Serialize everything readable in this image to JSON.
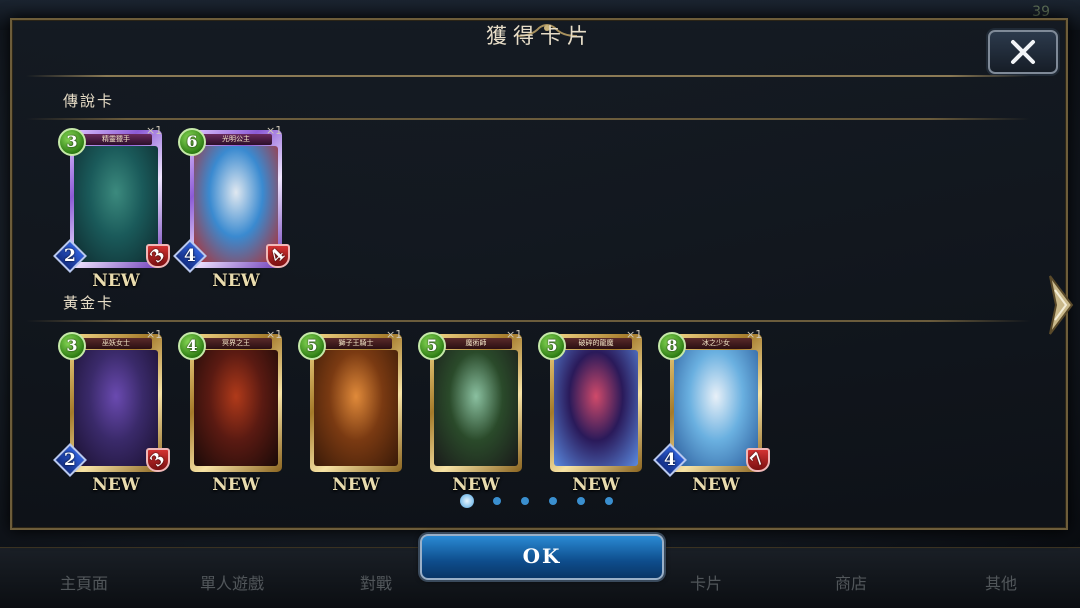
{
  "status_bar": {
    "clock": "39"
  },
  "dialog": {
    "title": "獲得卡片",
    "close_label": "✕",
    "ok_label": "OK"
  },
  "sections": [
    {
      "label": "傳說卡",
      "cards": [
        {
          "name": "精靈獵手",
          "cost": "3",
          "attack": "2",
          "defense": "3",
          "count": "×1",
          "badge": "NEW",
          "art": [
            "#1a5a5a",
            "#3c8a7e",
            "#0e2a2e"
          ]
        },
        {
          "name": "光明公主",
          "cost": "6",
          "attack": "4",
          "defense": "4",
          "count": "×1",
          "badge": "NEW",
          "art": [
            "#3a8ad0",
            "#e0e8f0",
            "#b82a2a"
          ]
        }
      ]
    },
    {
      "label": "黃金卡",
      "cards": [
        {
          "name": "巫妖女士",
          "cost": "3",
          "attack": "2",
          "defense": "3",
          "count": "×1",
          "badge": "NEW",
          "art": [
            "#3a2a6a",
            "#6a4ab0",
            "#1a1030"
          ]
        },
        {
          "name": "冥界之王",
          "cost": "4",
          "attack": "",
          "defense": "",
          "count": "×1",
          "badge": "NEW",
          "art": [
            "#5a1a12",
            "#b03a1a",
            "#1a0a08"
          ]
        },
        {
          "name": "獅子王騎士",
          "cost": "5",
          "attack": "",
          "defense": "",
          "count": "×1",
          "badge": "NEW",
          "art": [
            "#7a3a12",
            "#e08a3a",
            "#3a1a08"
          ]
        },
        {
          "name": "魔術師",
          "cost": "5",
          "attack": "",
          "defense": "",
          "count": "×1",
          "badge": "NEW",
          "art": [
            "#2a4a2a",
            "#8ac0a0",
            "#1a1a1a"
          ]
        },
        {
          "name": "破碎的龍魔",
          "cost": "5",
          "attack": "",
          "defense": "",
          "count": "×1",
          "badge": "NEW",
          "art": [
            "#2a1a5a",
            "#d04a6a",
            "#5a8ae0"
          ]
        },
        {
          "name": "冰之少女",
          "cost": "8",
          "attack": "4",
          "defense": "7",
          "count": "×1",
          "badge": "NEW",
          "art": [
            "#6ab0e0",
            "#e8f0f8",
            "#2a5a9a"
          ]
        }
      ]
    }
  ],
  "background_nav": [
    "主頁面",
    "單人遊戲",
    "對戰",
    "卡片",
    "商店",
    "其他"
  ],
  "pager": {
    "count": 6,
    "active": 0
  },
  "colors": {
    "accent": "#1a6fb8",
    "gold": "#6d5d3a",
    "new_text": "#e9dcae"
  },
  "icons": {
    "close": "close-icon",
    "next": "chevron-right-icon"
  }
}
